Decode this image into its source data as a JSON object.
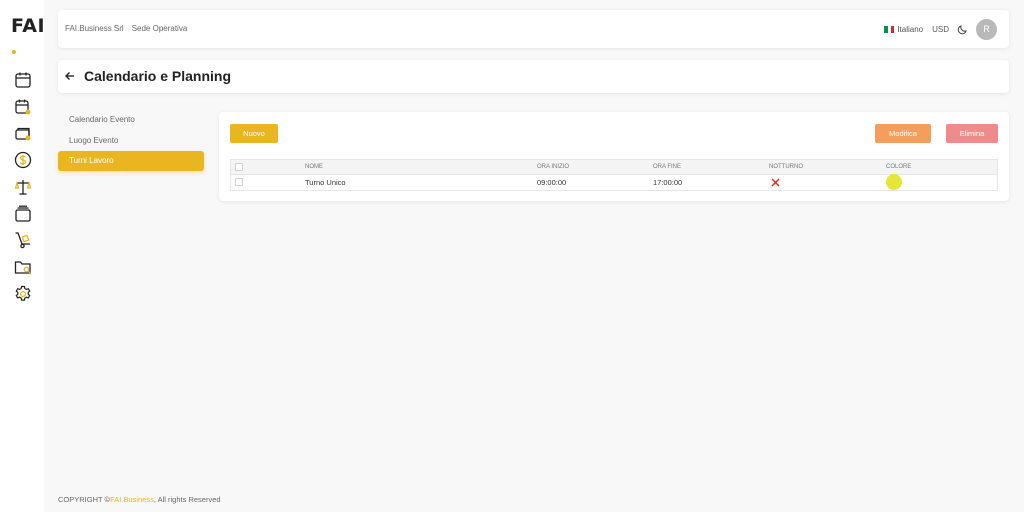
{
  "app": {
    "logo_text": "FAI",
    "accent_color": "#e9b621",
    "rail_icons": [
      "calendar-icon",
      "calendar-user-icon",
      "cards-icon",
      "dollar-icon",
      "scales-icon",
      "layers-icon",
      "hand-truck-icon",
      "folder-search-icon",
      "settings-gear-icon"
    ]
  },
  "header": {
    "company": "FAI.Business Srl",
    "location": "Sede Operativa",
    "language": "Italiano",
    "currency": "USD",
    "avatar_initial": "R"
  },
  "page": {
    "title": "Calendario e Planning"
  },
  "sidemenu": {
    "items": [
      {
        "label": "Calendario Evento",
        "active": false
      },
      {
        "label": "Luogo Evento",
        "active": false
      },
      {
        "label": "Turni Lavoro",
        "active": true
      }
    ]
  },
  "toolbar": {
    "new_label": "Nuovo",
    "edit_label": "Modifica",
    "delete_label": "Elimina"
  },
  "table": {
    "columns": [
      "NOME",
      "ORA INIZIO",
      "ORA FINE",
      "NOTTURNO",
      "COLORE"
    ],
    "rows": [
      {
        "nome": "Turno Unico",
        "ora_inizio": "09:00:00",
        "ora_fine": "17:00:00",
        "notturno": false,
        "colore": "#e6e63a"
      }
    ]
  },
  "footer": {
    "prefix": "COPYRIGHT ©",
    "brand": "FAI.Business",
    "suffix": ", All rights Reserved"
  }
}
